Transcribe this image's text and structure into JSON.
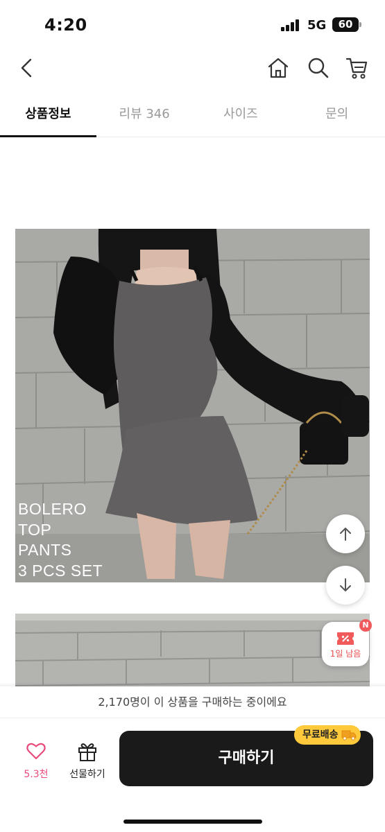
{
  "status_bar": {
    "time": "4:20",
    "network": "5G",
    "battery": "60"
  },
  "nav": {
    "back_icon": "chevron-left-icon",
    "home_icon": "home-icon",
    "search_icon": "search-icon",
    "cart_icon": "cart-icon"
  },
  "tabs": [
    {
      "label": "상품정보",
      "active": true
    },
    {
      "label": "리뷰 346",
      "active": false
    },
    {
      "label": "사이즈",
      "active": false
    },
    {
      "label": "문의",
      "active": false
    }
  ],
  "product_image": {
    "caption_lines": [
      "BOLERO",
      "TOP",
      "PANTS",
      "3 PCS SET"
    ]
  },
  "floating": {
    "scroll_up_icon": "arrow-up-icon",
    "scroll_down_icon": "arrow-down-icon",
    "coupon_badge": "N",
    "coupon_label": "1일 남음"
  },
  "notice": {
    "text": "2,170명이 이 상품을 구매하는 중이에요"
  },
  "actions": {
    "like_count": "5.3천",
    "gift_label": "선물하기",
    "buy_label": "구매하기",
    "free_shipping_label": "무료배송"
  },
  "colors": {
    "accent_pink": "#e84b7a",
    "buy_button": "#1a1a1a",
    "shipping_badge": "#ffc93c"
  }
}
